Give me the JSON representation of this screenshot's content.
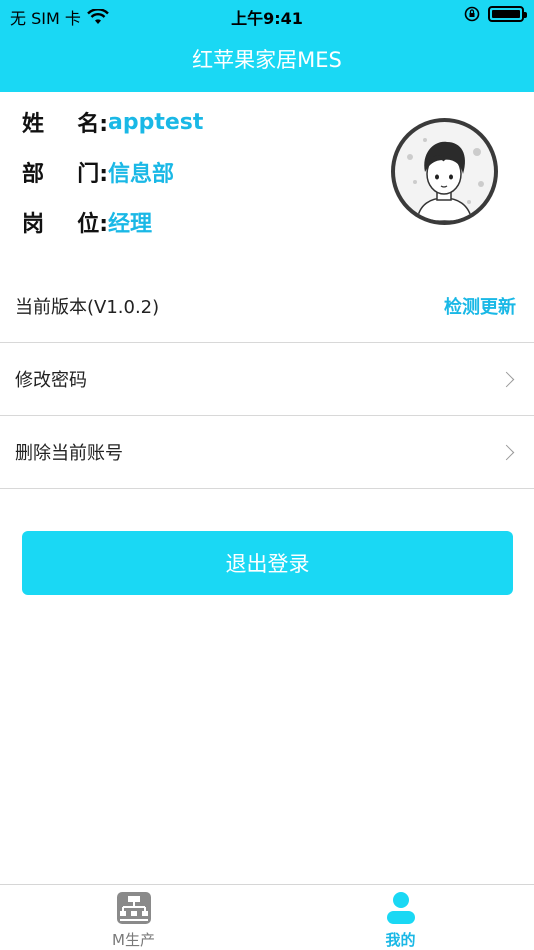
{
  "status_bar": {
    "carrier": "无 SIM 卡",
    "time": "上午9:41",
    "battery_level": 1.0
  },
  "header": {
    "title": "红苹果家居MES"
  },
  "profile": {
    "name_label_1": "姓",
    "name_label_2": "名:",
    "name_value": "apptest",
    "dept_label_1": "部",
    "dept_label_2": "门:",
    "dept_value": "信息部",
    "pos_label_1": "岗",
    "pos_label_2": "位:",
    "pos_value": "经理"
  },
  "menu": {
    "version_label": "当前版本(V1.0.2)",
    "check_update": "检测更新",
    "change_password": "修改密码",
    "delete_account": "删除当前账号"
  },
  "logout_button": "退出登录",
  "tabbar": {
    "tab1": "M生产",
    "tab2": "我的",
    "active_tab": "我的"
  },
  "colors": {
    "accent": "#1ad8f4",
    "link": "#1ab8e6"
  }
}
